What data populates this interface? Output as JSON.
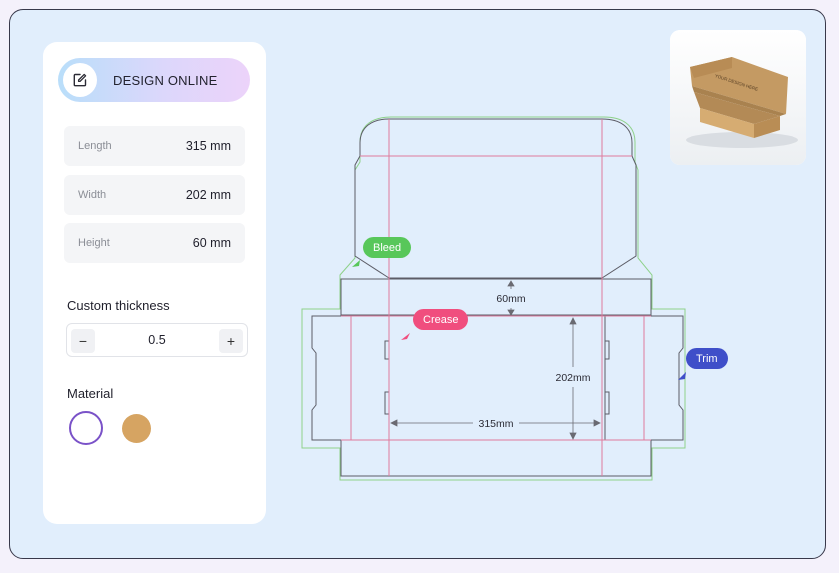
{
  "panel": {
    "design_button": {
      "label": "DESIGN ONLINE",
      "icon": "edit-square-icon"
    },
    "dimensions": [
      {
        "key": "Length",
        "value": "315 mm"
      },
      {
        "key": "Width",
        "value": "202 mm"
      },
      {
        "key": "Height",
        "value": "60 mm"
      }
    ],
    "thickness": {
      "title": "Custom thickness",
      "minus": "−",
      "value": "0.5",
      "plus": "+"
    },
    "material": {
      "title": "Material",
      "swatches": [
        {
          "name": "white",
          "color": "#ffffff",
          "selected": true
        },
        {
          "name": "kraft",
          "color": "#d6a462",
          "selected": false
        }
      ]
    }
  },
  "dieline": {
    "labels": {
      "height": "60mm",
      "width": "202mm",
      "length": "315mm"
    },
    "tags": {
      "bleed": "Bleed",
      "crease": "Crease",
      "trim": "Trim"
    },
    "colors": {
      "bleed": "#58c75a",
      "crease": "#f04e7e",
      "trim": "#3f4fc9",
      "crease_line": "#e07a9d",
      "cut_line": "#5c5c66"
    }
  },
  "preview": {
    "box_print": "YOUR DESIGN HERE",
    "icon": "mailer-box-preview"
  }
}
